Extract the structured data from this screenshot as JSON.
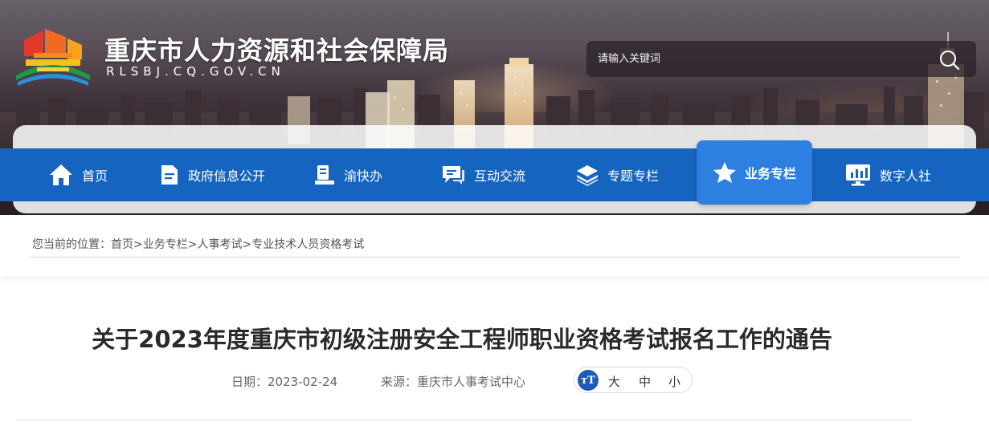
{
  "header": {
    "site_title": "重庆市人力资源和社会保障局",
    "site_domain": "RLSBJ.CQ.GOV.CN",
    "search": {
      "placeholder": "请输入关键词"
    }
  },
  "nav": {
    "items": [
      {
        "label": "首页",
        "icon": "home-icon"
      },
      {
        "label": "政府信息公开",
        "icon": "document-icon"
      },
      {
        "label": "渝快办",
        "icon": "service-desk-icon"
      },
      {
        "label": "互动交流",
        "icon": "chat-icon"
      },
      {
        "label": "专题专栏",
        "icon": "layers-icon"
      },
      {
        "label": "业务专栏",
        "icon": "star-icon",
        "active": true
      },
      {
        "label": "数字人社",
        "icon": "monitor-chart-icon"
      }
    ]
  },
  "breadcrumb": {
    "prefix": "您当前的位置：",
    "items": [
      "首页",
      "业务专栏",
      "人事考试",
      "专业技术人员资格考试"
    ],
    "separator": ">"
  },
  "article": {
    "title": "关于2023年度重庆市初级注册安全工程师职业资格考试报名工作的通告",
    "date_label": "日期：",
    "date": "2023-02-24",
    "source_label": "来源：",
    "source": "重庆市人事考试中心"
  },
  "font_size": {
    "icon_text": "тT",
    "options": [
      "大",
      "中",
      "小"
    ]
  },
  "colors": {
    "nav_blue": "#1564c0",
    "nav_active": "#2d7fe0",
    "fontsize_icon": "#1f5bb5"
  }
}
